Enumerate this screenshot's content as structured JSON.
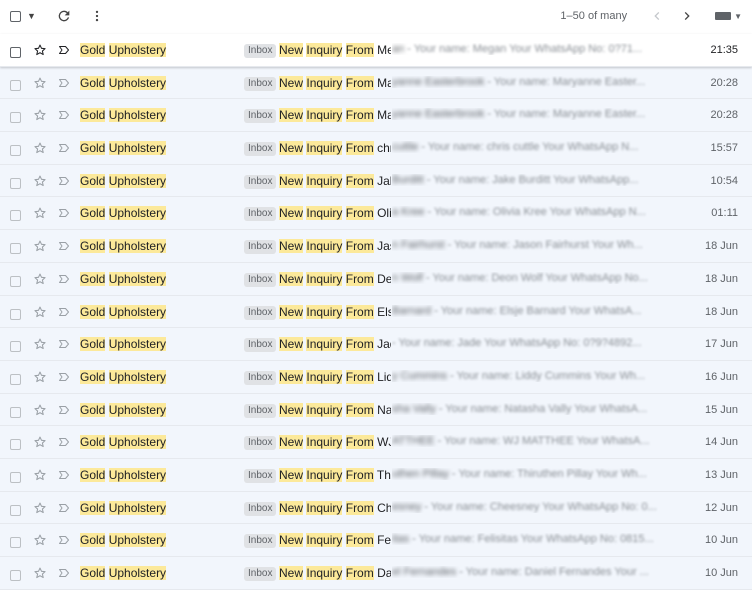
{
  "toolbar": {
    "pager_text": "1–50 of many"
  },
  "email_rows": [
    {
      "sender": [
        "Gold",
        "Upholstery"
      ],
      "label": "Inbox",
      "subject": [
        "New",
        "Inquiry",
        "From"
      ],
      "name_visible": "Meg",
      "name_blurred": "an",
      "preview": " - Your name: Megan Your WhatsApp No: 0?71...",
      "date": "21:35"
    },
    {
      "sender": [
        "Gold",
        "Upholstery"
      ],
      "label": "Inbox",
      "subject": [
        "New",
        "Inquiry",
        "From"
      ],
      "name_visible": "Mar",
      "name_blurred": "yanne Easterbrook",
      "preview": " - Your name: Maryanne Easter...",
      "date": "20:28"
    },
    {
      "sender": [
        "Gold",
        "Upholstery"
      ],
      "label": "Inbox",
      "subject": [
        "New",
        "Inquiry",
        "From"
      ],
      "name_visible": "Mar",
      "name_blurred": "yanne Easterbrook",
      "preview": " - Your name: Maryanne Easter...",
      "date": "20:28"
    },
    {
      "sender": [
        "Gold",
        "Upholstery"
      ],
      "label": "Inbox",
      "subject": [
        "New",
        "Inquiry",
        "From"
      ],
      "name_visible": "chris",
      "name_blurred": " cuttle",
      "preview": " - Your name: chris cuttle Your WhatsApp N...",
      "date": "15:57"
    },
    {
      "sender": [
        "Gold",
        "Upholstery"
      ],
      "label": "Inbox",
      "subject": [
        "New",
        "Inquiry",
        "From"
      ],
      "name_visible": "Jake",
      "name_blurred": " Burditt",
      "preview": " - Your name: Jake Burditt Your WhatsApp...",
      "date": "10:54"
    },
    {
      "sender": [
        "Gold",
        "Upholstery"
      ],
      "label": "Inbox",
      "subject": [
        "New",
        "Inquiry",
        "From"
      ],
      "name_visible": "Olivi",
      "name_blurred": "a Kree",
      "preview": " - Your name: Olivia Kree Your WhatsApp N...",
      "date": "01:11"
    },
    {
      "sender": [
        "Gold",
        "Upholstery"
      ],
      "label": "Inbox",
      "subject": [
        "New",
        "Inquiry",
        "From"
      ],
      "name_visible": "Jaso",
      "name_blurred": "n Fairhurst",
      "preview": " - Your name: Jason Fairhurst Your Wh...",
      "date": "18 Jun"
    },
    {
      "sender": [
        "Gold",
        "Upholstery"
      ],
      "label": "Inbox",
      "subject": [
        "New",
        "Inquiry",
        "From"
      ],
      "name_visible": "Deo",
      "name_blurred": "n Wolf",
      "preview": " - Your name: Deon Wolf Your WhatsApp No...",
      "date": "18 Jun"
    },
    {
      "sender": [
        "Gold",
        "Upholstery"
      ],
      "label": "Inbox",
      "subject": [
        "New",
        "Inquiry",
        "From"
      ],
      "name_visible": "Elsje",
      "name_blurred": " Barnard",
      "preview": " - Your name: Elsje Barnard Your WhatsA...",
      "date": "18 Jun"
    },
    {
      "sender": [
        "Gold",
        "Upholstery"
      ],
      "label": "Inbox",
      "subject": [
        "New",
        "Inquiry",
        "From"
      ],
      "name_visible": "Jade",
      "name_blurred": "",
      "preview": " - Your name: Jade Your WhatsApp No: 0?9?4892...",
      "date": "17 Jun"
    },
    {
      "sender": [
        "Gold",
        "Upholstery"
      ],
      "label": "Inbox",
      "subject": [
        "New",
        "Inquiry",
        "From"
      ],
      "name_visible": "Lidd",
      "name_blurred": "y Cummins",
      "preview": " - Your name: Liddy Cummins Your Wh...",
      "date": "16 Jun"
    },
    {
      "sender": [
        "Gold",
        "Upholstery"
      ],
      "label": "Inbox",
      "subject": [
        "New",
        "Inquiry",
        "From"
      ],
      "name_visible": "Nata",
      "name_blurred": "sha Vally",
      "preview": " - Your name: Natasha Vally Your WhatsA...",
      "date": "15 Jun"
    },
    {
      "sender": [
        "Gold",
        "Upholstery"
      ],
      "label": "Inbox",
      "subject": [
        "New",
        "Inquiry",
        "From"
      ],
      "name_visible": "WJ M",
      "name_blurred": "ATTHEE",
      "preview": " - Your name: WJ MATTHEE Your WhatsA...",
      "date": "14 Jun"
    },
    {
      "sender": [
        "Gold",
        "Upholstery"
      ],
      "label": "Inbox",
      "subject": [
        "New",
        "Inquiry",
        "From"
      ],
      "name_visible": "Thir",
      "name_blurred": "uthen Pillay",
      "preview": " - Your name: Thiruthen Pillay Your Wh...",
      "date": "13 Jun"
    },
    {
      "sender": [
        "Gold",
        "Upholstery"
      ],
      "label": "Inbox",
      "subject": [
        "New",
        "Inquiry",
        "From"
      ],
      "name_visible": "Che",
      "name_blurred": "esney",
      "preview": " - Your name: Cheesney Your WhatsApp No: 0...",
      "date": "12 Jun"
    },
    {
      "sender": [
        "Gold",
        "Upholstery"
      ],
      "label": "Inbox",
      "subject": [
        "New",
        "Inquiry",
        "From"
      ],
      "name_visible": "Felis",
      "name_blurred": "itas",
      "preview": " - Your name: Felisitas Your WhatsApp No: 0815...",
      "date": "10 Jun"
    },
    {
      "sender": [
        "Gold",
        "Upholstery"
      ],
      "label": "Inbox",
      "subject": [
        "New",
        "Inquiry",
        "From"
      ],
      "name_visible": "Dani",
      "name_blurred": "el Fernandes",
      "preview": " - Your name: Daniel Fernandes Your ...",
      "date": "10 Jun"
    }
  ]
}
